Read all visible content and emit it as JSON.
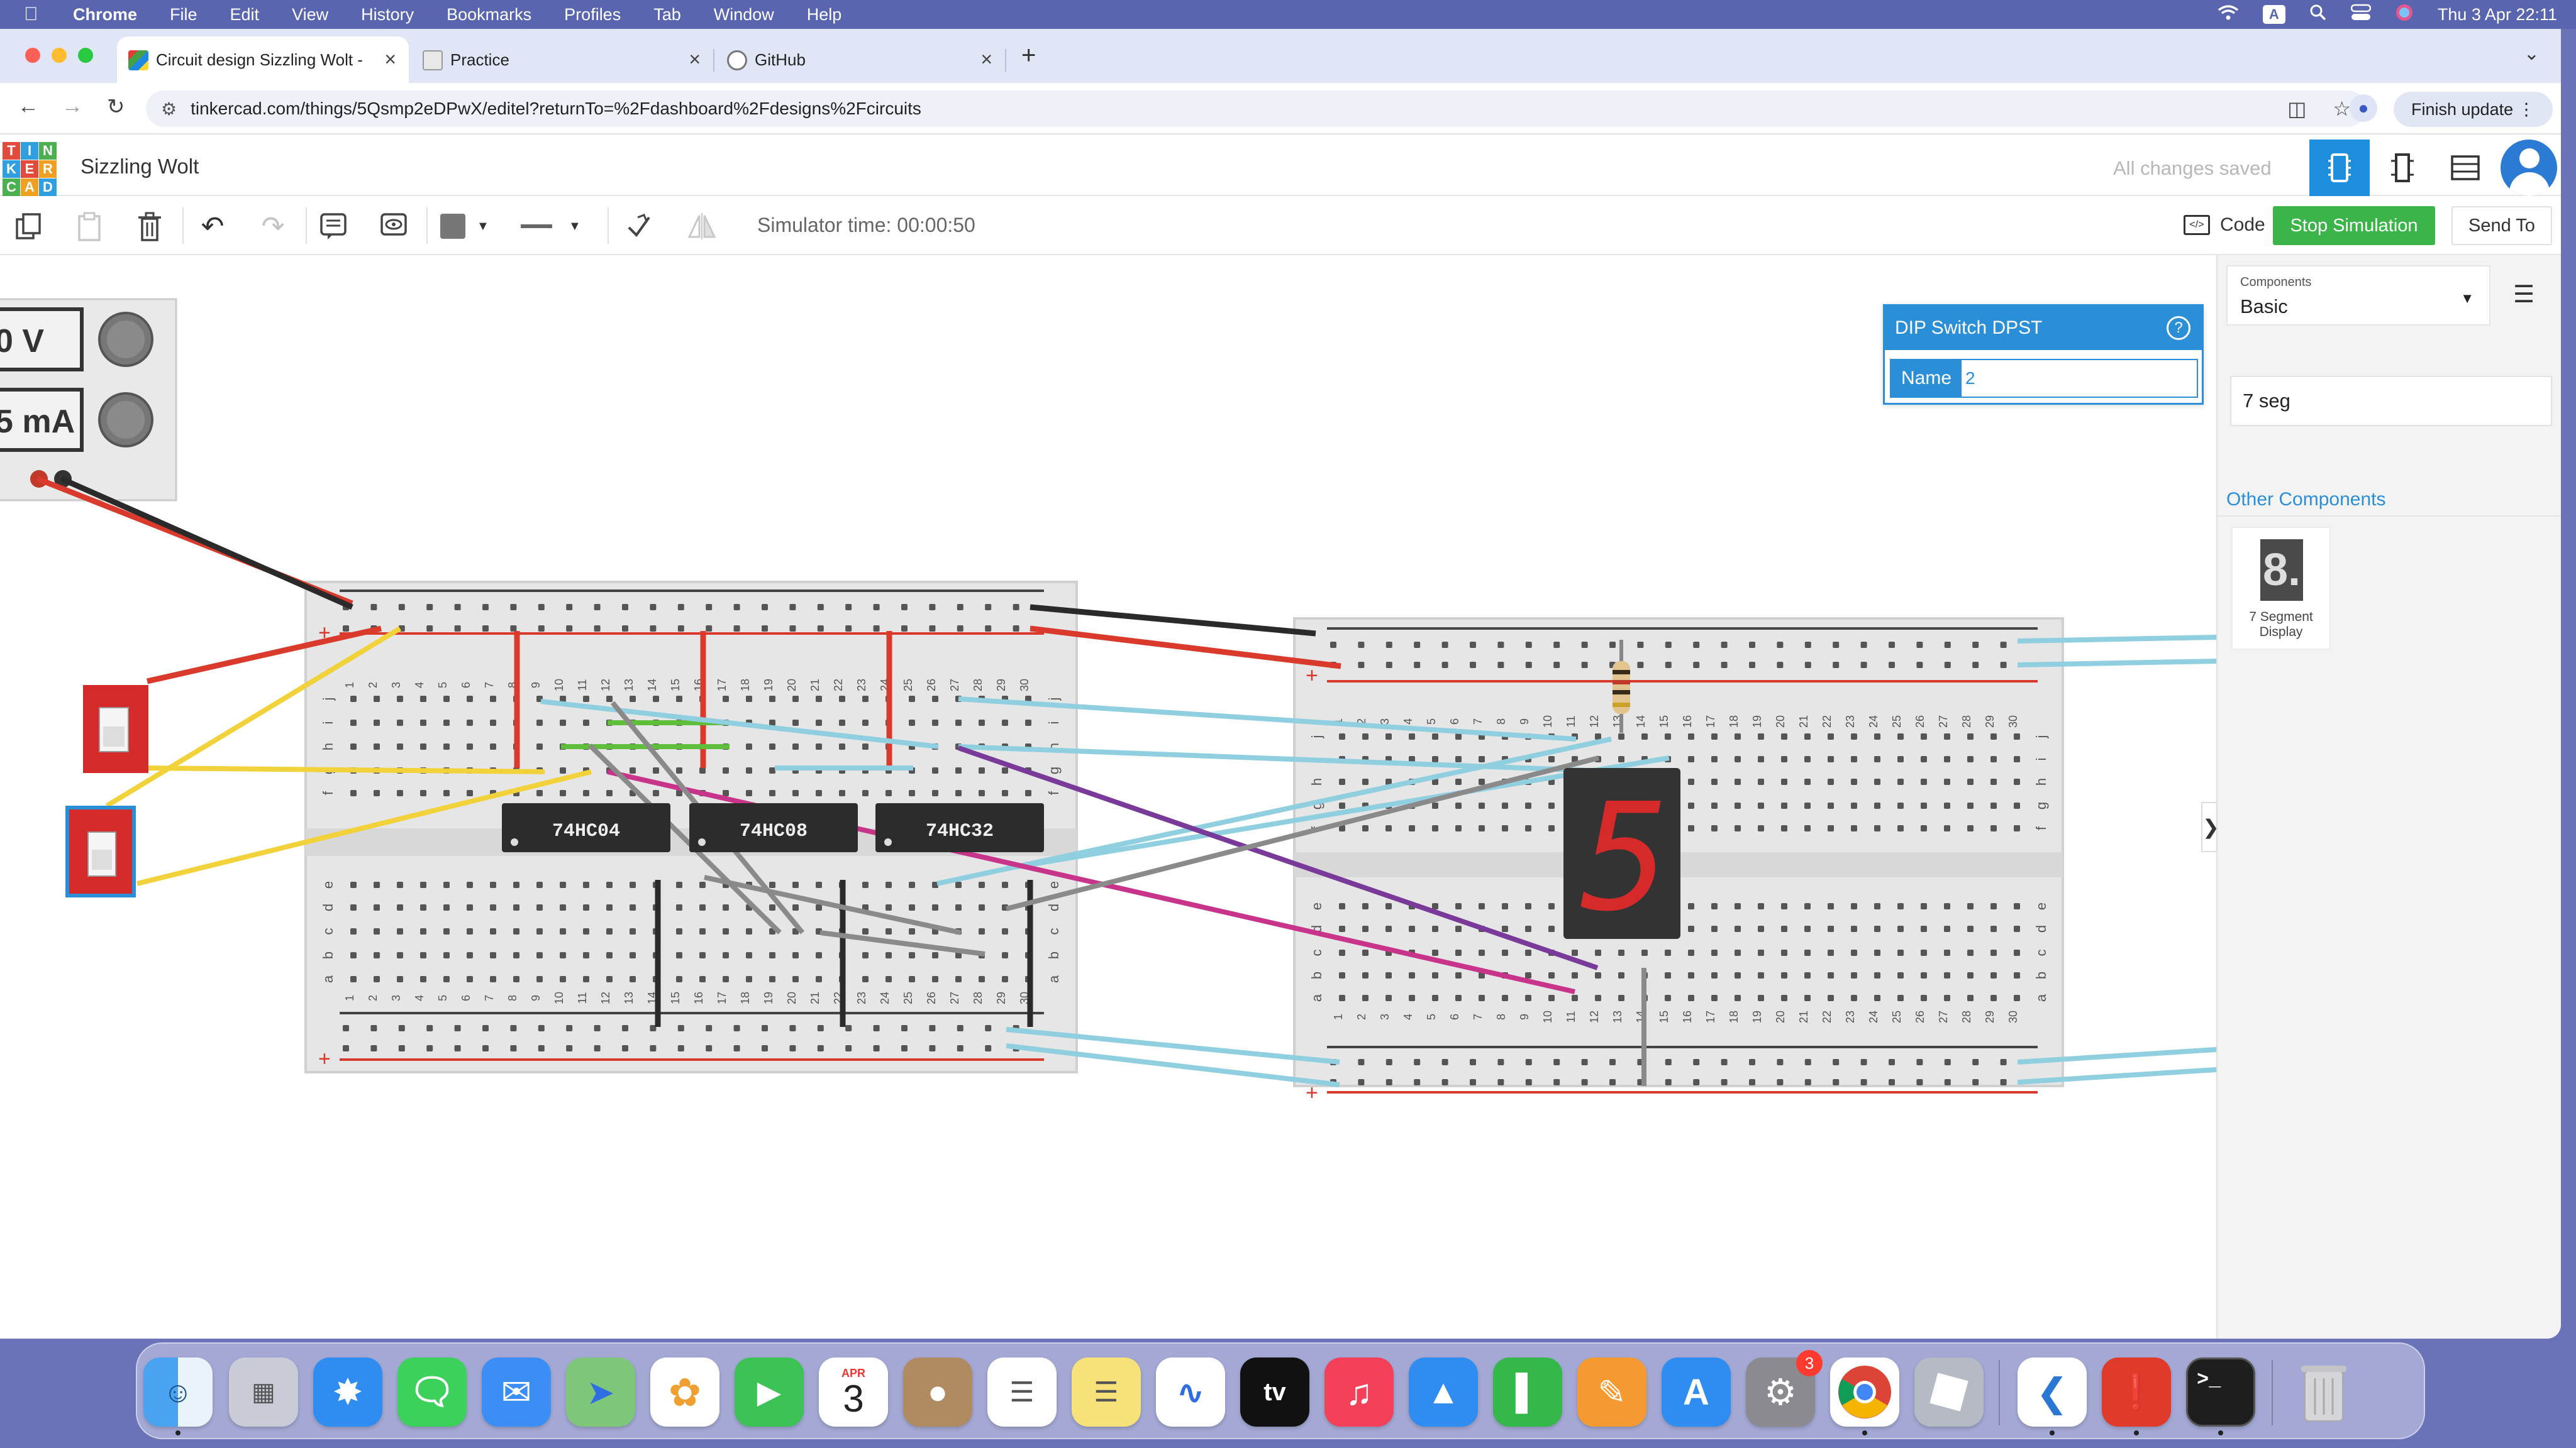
{
  "menubar": {
    "apple": "",
    "app_name": "Chrome",
    "items": [
      "File",
      "Edit",
      "View",
      "History",
      "Bookmarks",
      "Profiles",
      "Tab",
      "Window",
      "Help"
    ],
    "input_source": "A",
    "clock": "Thu 3 Apr  22:11"
  },
  "browser": {
    "tabs": [
      {
        "title": "Circuit design Sizzling Wolt -",
        "active": true
      },
      {
        "title": "Practice",
        "active": false
      },
      {
        "title": "GitHub",
        "active": false
      }
    ],
    "url": "tinkercad.com/things/5Qsmp2eDPwX/editel?returnTo=%2Fdashboard%2Fdesigns%2Fcircuits",
    "finish_update": "Finish update"
  },
  "tinkercad": {
    "logo_letters": [
      "T",
      "I",
      "N",
      "K",
      "E",
      "R",
      "C",
      "A",
      "D"
    ],
    "design_name": "Sizzling Wolt",
    "save_status": "All changes saved",
    "simulator_time": "Simulator time: 00:00:50",
    "code_label": "Code",
    "stop_label": "Stop Simulation",
    "send_label": "Send To"
  },
  "inspector": {
    "title": "DIP Switch DPST",
    "help": "?",
    "name_label": "Name",
    "name_value": "2"
  },
  "power_supply": {
    "voltage": "0 V",
    "current": "5 mA"
  },
  "chips": [
    "74HC04",
    "74HC08",
    "74HC32"
  ],
  "seven_segment_digit": "5",
  "breadboard": {
    "row_letters_top": [
      "j",
      "i",
      "h",
      "g",
      "f"
    ],
    "row_letters_bottom": [
      "e",
      "d",
      "c",
      "b",
      "a"
    ],
    "columns": [
      "1",
      "2",
      "3",
      "4",
      "5",
      "6",
      "7",
      "8",
      "9",
      "10",
      "11",
      "12",
      "13",
      "14",
      "15",
      "16",
      "17",
      "18",
      "19",
      "20",
      "21",
      "22",
      "23",
      "24",
      "25",
      "26",
      "27",
      "28",
      "29",
      "30"
    ],
    "plus": "+",
    "minus": "−"
  },
  "sidebar": {
    "components_caption": "Components",
    "components_value": "Basic",
    "search_value": "7 seg",
    "other_title": "Other Components",
    "result_name": "7 Segment Display",
    "collapse": "❯"
  },
  "dock": {
    "calendar_month": "APR",
    "calendar_day": "3",
    "settings_badge": "3",
    "apps": [
      "Finder",
      "Launchpad",
      "Safari",
      "Messages",
      "Mail",
      "Maps",
      "Photos",
      "FaceTime",
      "Calendar",
      "Contacts",
      "Reminders",
      "Notes",
      "Freeform",
      "TV",
      "Music",
      "Keynote",
      "Numbers",
      "Pages",
      "App Store",
      "System Settings",
      "Chrome",
      "Roblox",
      "VS Code",
      "Acrobat",
      "Terminal",
      "Trash"
    ]
  },
  "colors": {
    "accent_blue": "#2b8fd8",
    "stop_green": "#3bb44a",
    "wire_red": "#d93a2b",
    "wire_black": "#2a2a2a",
    "wire_yellow": "#f2d23a",
    "wire_cyan": "#8fcfe0",
    "wire_purple": "#7a3a9a",
    "wire_magenta": "#c8348a",
    "wire_gray": "#8a8a8a",
    "wire_green": "#5fbf3a"
  }
}
